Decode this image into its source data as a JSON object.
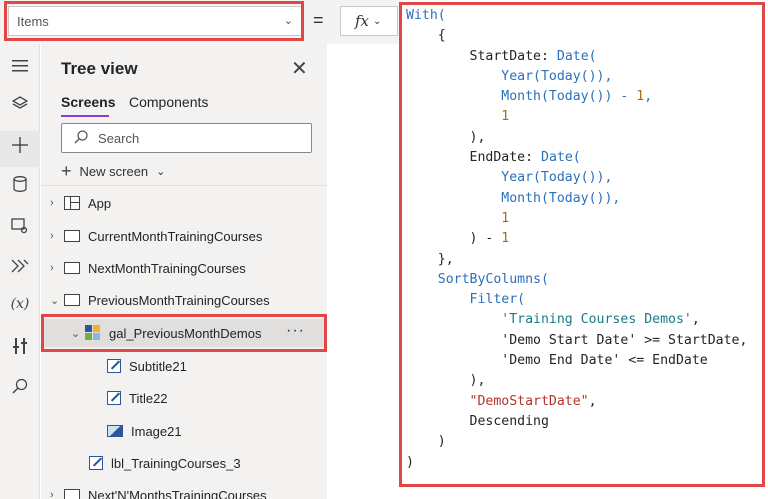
{
  "formula_bar": {
    "property": "Items",
    "equals": "=",
    "fx_label": "fx"
  },
  "rail": {
    "icons": [
      "hamburger-icon",
      "layers-icon",
      "plus-icon",
      "database-icon",
      "media-icon",
      "power-automate-icon",
      "variables-icon",
      "tools-icon",
      "search-icon"
    ],
    "variables_label": "(x)"
  },
  "tree": {
    "title": "Tree view",
    "tabs": [
      "Screens",
      "Components"
    ],
    "search_placeholder": "Search",
    "new_screen": "New screen",
    "nodes": [
      {
        "label": "App"
      },
      {
        "label": "CurrentMonthTrainingCourses"
      },
      {
        "label": "NextMonthTrainingCourses"
      },
      {
        "label": "PreviousMonthTrainingCourses"
      },
      {
        "label": "gal_PreviousMonthDemos"
      },
      {
        "label": "Subtitle21"
      },
      {
        "label": "Title22"
      },
      {
        "label": "Image21"
      },
      {
        "label": "lbl_TrainingCourses_3"
      },
      {
        "label": "Next'N'MonthsTrainingCourses"
      }
    ],
    "more": "···"
  },
  "code": {
    "l1": "With(",
    "l2": "{",
    "l3_a": "StartDate: ",
    "l3_b": "Date(",
    "l4": "Year(Today()),",
    "l5_a": "Month(Today()) - ",
    "l5_b": "1",
    "l5_c": ",",
    "l6": "1",
    "l7": "),",
    "l8_a": "EndDate: ",
    "l8_b": "Date(",
    "l9": "Year(Today()),",
    "l10": "Month(Today()),",
    "l11": "1",
    "l12_a": ") - ",
    "l12_b": "1",
    "l13": "},",
    "l14": "SortByColumns(",
    "l15": "Filter(",
    "l16_a": "'Training Courses Demos'",
    "l16_b": ",",
    "l17": "'Demo Start Date' >= StartDate,",
    "l18": "'Demo End Date' <= EndDate",
    "l19": "),",
    "l20_a": "\"DemoStartDate\"",
    "l20_b": ",",
    "l21": "Descending",
    "l22": ")",
    "l23": ")"
  }
}
